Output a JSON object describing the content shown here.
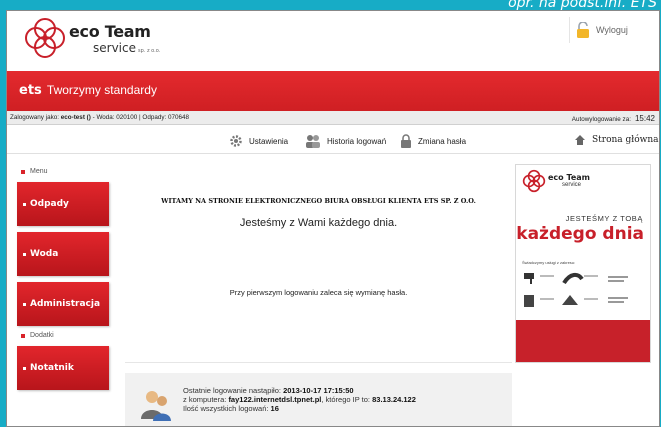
{
  "caption": "opr. na podst.inf. ETS",
  "header": {
    "brand": "eco Team",
    "brand_sub": "service",
    "brand_legal": "sp. z o.o.",
    "logout_label": "Wyloguj"
  },
  "banner": {
    "prefix": "ets",
    "slogan": "Tworzymy standardy"
  },
  "status": {
    "login_prefix": "Zalogowany jako:",
    "login_user": "eco-test ()",
    "login_rest": " - Woda: 020100 | Odpady: 070648",
    "autologout_label": "Autowylogowanie za:",
    "autologout_value": "15:42"
  },
  "toolbar": {
    "settings": "Ustawienia",
    "history": "Historia logowań",
    "password": "Zmiana hasła",
    "home": "Strona główna"
  },
  "sidebar": {
    "menu_label": "Menu",
    "extras_label": "Dodatki",
    "items": [
      "Odpady",
      "Woda",
      "Administracja",
      "Notatnik"
    ]
  },
  "content": {
    "welcome": "WITAMY NA STRONIE ELEKTRONICZNEGO BIURA OBSŁUGI KLIENTA ETS SP. Z O.O.",
    "tagline": "Jesteśmy z Wami każdego dnia.",
    "advice": "Przy pierwszym logowaniu zaleca się wymianę hasła."
  },
  "ad": {
    "brand": "eco Team",
    "brand_sub": "service",
    "line1": "JESTEŚMY Z TOBĄ",
    "line2": "każdego dnia",
    "intro": "Świadczymy usługi z zakresu:"
  },
  "last_login": {
    "line1_label": "Ostatnie logowanie nastąpiło: ",
    "line1_value": "2013-10-17 17:15:50",
    "line2_label": "z komputera: ",
    "line2_host": "fay122.internetdsl.tpnet.pl",
    "line2_mid": ", którego IP to: ",
    "line2_ip": "83.13.24.122",
    "line3_label": "Ilość wszystkich logowań: ",
    "line3_value": "16"
  },
  "colors": {
    "accent_red": "#d9232a",
    "background_teal": "#17acc6"
  }
}
